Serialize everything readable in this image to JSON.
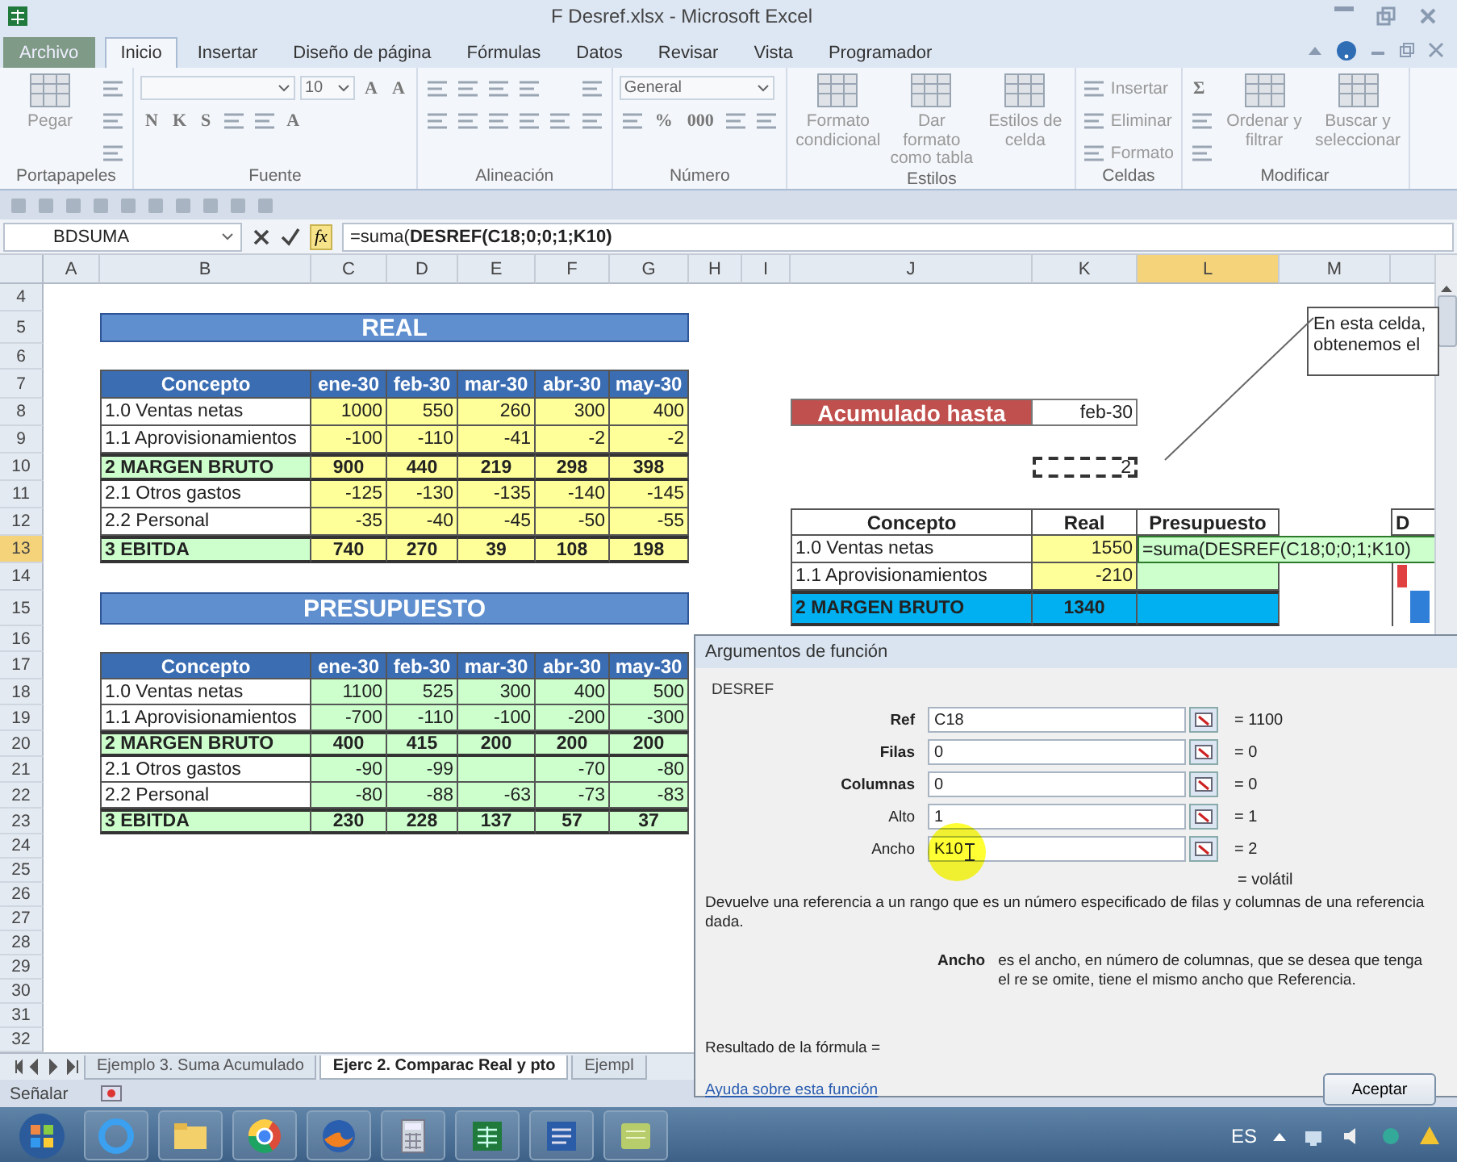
{
  "window": {
    "title": "F  Desref.xlsx  -  Microsoft Excel"
  },
  "ribbon_tabs": [
    {
      "label": "Archivo",
      "kind": "file",
      "selected": false
    },
    {
      "label": "Inicio",
      "kind": "tab",
      "selected": true
    },
    {
      "label": "Insertar",
      "kind": "tab",
      "selected": false
    },
    {
      "label": "Diseño de página",
      "kind": "tab",
      "selected": false
    },
    {
      "label": "Fórmulas",
      "kind": "tab",
      "selected": false
    },
    {
      "label": "Datos",
      "kind": "tab",
      "selected": false
    },
    {
      "label": "Revisar",
      "kind": "tab",
      "selected": false
    },
    {
      "label": "Vista",
      "kind": "tab",
      "selected": false
    },
    {
      "label": "Programador",
      "kind": "tab",
      "selected": false
    }
  ],
  "ribbon_groups": [
    {
      "label": "Portapapeles",
      "columns": [
        {
          "kind": "large",
          "label": "Pegar"
        },
        {
          "kind": "stack",
          "rows": [
            [
              {
                "kind": "icon"
              }
            ],
            [
              {
                "kind": "icon"
              }
            ],
            [
              {
                "kind": "icon"
              }
            ]
          ]
        }
      ]
    },
    {
      "label": "Fuente",
      "columns": [
        {
          "kind": "stack",
          "rows": [
            [
              {
                "kind": "wide_field"
              },
              {
                "kind": "field",
                "value": "10"
              },
              {
                "kind": "glyph",
                "label": "A"
              },
              {
                "kind": "glyph",
                "label": "A"
              }
            ],
            [
              {
                "kind": "glyph",
                "label": "N"
              },
              {
                "kind": "glyph",
                "label": "K"
              },
              {
                "kind": "glyph",
                "label": "S"
              },
              {
                "kind": "icon"
              },
              {
                "kind": "icon"
              },
              {
                "kind": "glyph",
                "label": "A"
              }
            ]
          ]
        }
      ]
    },
    {
      "label": "Alineación",
      "columns": [
        {
          "kind": "stack",
          "rows": [
            [
              {
                "kind": "icon"
              },
              {
                "kind": "icon"
              },
              {
                "kind": "icon"
              },
              {
                "kind": "icon"
              }
            ],
            [
              {
                "kind": "icon"
              },
              {
                "kind": "icon"
              },
              {
                "kind": "icon"
              },
              {
                "kind": "icon"
              },
              {
                "kind": "icon"
              }
            ]
          ]
        },
        {
          "kind": "stack",
          "rows": [
            [
              {
                "kind": "icon"
              }
            ],
            [
              {
                "kind": "icon"
              }
            ]
          ]
        }
      ]
    },
    {
      "label": "Número",
      "columns": [
        {
          "kind": "stack",
          "rows": [
            [
              {
                "kind": "wide_field",
                "value": "General"
              }
            ],
            [
              {
                "kind": "icon"
              },
              {
                "kind": "glyph",
                "label": "%"
              },
              {
                "kind": "glyph",
                "label": "000"
              },
              {
                "kind": "icon"
              },
              {
                "kind": "icon"
              }
            ]
          ]
        }
      ]
    },
    {
      "label": "Estilos",
      "columns": [
        {
          "kind": "large",
          "label": "Formato condicional"
        },
        {
          "kind": "large",
          "label": "Dar formato como tabla"
        },
        {
          "kind": "large",
          "label": "Estilos de celda"
        }
      ]
    },
    {
      "label": "Celdas",
      "columns": [
        {
          "kind": "stack",
          "rows": [
            [
              {
                "kind": "small",
                "label": "Insertar"
              }
            ],
            [
              {
                "kind": "small",
                "label": "Eliminar"
              }
            ],
            [
              {
                "kind": "small",
                "label": "Formato"
              }
            ]
          ]
        }
      ]
    },
    {
      "label": "Modificar",
      "columns": [
        {
          "kind": "stack",
          "rows": [
            [
              {
                "kind": "glyph",
                "label": "Σ"
              }
            ],
            [
              {
                "kind": "icon"
              }
            ],
            [
              {
                "kind": "icon"
              }
            ]
          ]
        },
        {
          "kind": "large",
          "label": "Ordenar y filtrar"
        },
        {
          "kind": "large",
          "label": "Buscar y seleccionar"
        }
      ]
    }
  ],
  "formula_bar": {
    "name_box": "BDSUMA",
    "function_label": "fx",
    "formula": "=suma(**DESREF(C18;0;0;1;K10)**"
  },
  "sheet": {
    "columns": [
      {
        "label": "A",
        "selected": false
      },
      {
        "label": "B",
        "selected": false
      },
      {
        "label": "C",
        "selected": false
      },
      {
        "label": "D",
        "selected": false
      },
      {
        "label": "E",
        "selected": false
      },
      {
        "label": "F",
        "selected": false
      },
      {
        "label": "G",
        "selected": false
      },
      {
        "label": "H",
        "selected": false
      },
      {
        "label": "I",
        "selected": false
      },
      {
        "label": "J",
        "selected": false
      },
      {
        "label": "K",
        "selected": false
      },
      {
        "label": "L",
        "selected": true
      },
      {
        "label": "M",
        "selected": false
      }
    ],
    "rows": [
      {
        "label": "4",
        "selected": false
      },
      {
        "label": "5",
        "selected": false
      },
      {
        "label": "6",
        "selected": false
      },
      {
        "label": "7",
        "selected": false
      },
      {
        "label": "8",
        "selected": false
      },
      {
        "label": "9",
        "selected": false
      },
      {
        "label": "10",
        "selected": false
      },
      {
        "label": "11",
        "selected": false
      },
      {
        "label": "12",
        "selected": false
      },
      {
        "label": "13",
        "selected": true
      },
      {
        "label": "14",
        "selected": false
      },
      {
        "label": "15",
        "selected": false
      },
      {
        "label": "16",
        "selected": false
      },
      {
        "label": "17",
        "selected": false
      },
      {
        "label": "18",
        "selected": false
      },
      {
        "label": "19",
        "selected": false
      },
      {
        "label": "20",
        "selected": false
      },
      {
        "label": "21",
        "selected": false
      },
      {
        "label": "22",
        "selected": false
      },
      {
        "label": "23",
        "selected": false
      },
      {
        "label": "24",
        "selected": false
      },
      {
        "label": "25",
        "selected": false
      },
      {
        "label": "26",
        "selected": false
      },
      {
        "label": "27",
        "selected": false
      },
      {
        "label": "28",
        "selected": false
      },
      {
        "label": "29",
        "selected": false
      },
      {
        "label": "30",
        "selected": false
      },
      {
        "label": "31",
        "selected": false
      },
      {
        "label": "32",
        "selected": false
      }
    ],
    "real_table": {
      "banner": "REAL",
      "columns": [
        "Concepto",
        "ene-30",
        "feb-30",
        "mar-30",
        "abr-30",
        "may-30"
      ],
      "rows": [
        {
          "kind": "item",
          "label": "1.0 Ventas netas",
          "values": [
            "1000",
            "550",
            "260",
            "300",
            "400"
          ]
        },
        {
          "kind": "item",
          "label": "1.1 Aprovisionamientos",
          "values": [
            "-100",
            "-110",
            "-41",
            "-2",
            "-2"
          ]
        },
        {
          "kind": "total",
          "label": "2 MARGEN BRUTO",
          "values": [
            "900",
            "440",
            "219",
            "298",
            "398"
          ]
        },
        {
          "kind": "item",
          "label": "2.1 Otros gastos",
          "values": [
            "-125",
            "-130",
            "-135",
            "-140",
            "-145"
          ]
        },
        {
          "kind": "item",
          "label": "2.2 Personal",
          "values": [
            "-35",
            "-40",
            "-45",
            "-50",
            "-55"
          ]
        },
        {
          "kind": "total",
          "label": "3 EBITDA",
          "values": [
            "740",
            "270",
            "39",
            "108",
            "198"
          ]
        }
      ]
    },
    "budget_table": {
      "banner": "PRESUPUESTO",
      "columns": [
        "Concepto",
        "ene-30",
        "feb-30",
        "mar-30",
        "abr-30",
        "may-30"
      ],
      "rows": [
        {
          "kind": "item",
          "label": "1.0 Ventas netas",
          "values": [
            "1100",
            "525",
            "300",
            "400",
            "500"
          ]
        },
        {
          "kind": "item",
          "label": "1.1 Aprovisionamientos",
          "values": [
            "-700",
            "-110",
            "-100",
            "-200",
            "-300"
          ]
        },
        {
          "kind": "total",
          "label": "2 MARGEN BRUTO",
          "values": [
            "400",
            "415",
            "200",
            "200",
            "200"
          ]
        },
        {
          "kind": "item",
          "label": "2.1 Otros gastos",
          "values": [
            "-90",
            "-99",
            {
              "kind": "empty"
            },
            "-70",
            "-80"
          ]
        },
        {
          "kind": "item",
          "label": "2.2 Personal",
          "values": [
            "-80",
            "-88",
            "-63",
            "-73",
            "-83"
          ]
        },
        {
          "kind": "total",
          "label": "3 EBITDA",
          "values": [
            "230",
            "228",
            "137",
            "57",
            "37"
          ]
        }
      ]
    },
    "cutoff": {
      "label": "Acumulado hasta",
      "value": "feb-30"
    },
    "copied_cell": {
      "value": "2"
    },
    "comparison_table": {
      "columns": [
        "Concepto",
        "Real",
        "Presupuesto"
      ],
      "rows": [
        {
          "kind": "item",
          "label": "1.0 Ventas netas",
          "real": "1550",
          "budget": "=suma(DESREF(C18;0;0;1;K10)",
          "editing": true
        },
        {
          "kind": "item",
          "label": "1.1 Aprovisionamientos",
          "real": "-210",
          "editing": false
        },
        {
          "kind": "total",
          "label": "2 MARGEN BRUTO",
          "real": "1340",
          "editing": false
        }
      ]
    },
    "partial_header": "D",
    "callout": {
      "lines": [
        "En esta celda,",
        "obtenemos el"
      ]
    }
  },
  "dialog": {
    "title": "Argumentos de función",
    "function": "DESREF",
    "args": [
      {
        "label": "Ref",
        "required": true,
        "value": "C18",
        "result": "= 1100"
      },
      {
        "label": "Filas",
        "required": true,
        "value": "0",
        "result": "= 0"
      },
      {
        "label": "Columnas",
        "required": true,
        "value": "0",
        "result": "= 0"
      },
      {
        "label": "Alto",
        "required": false,
        "value": "1",
        "result": "= 1"
      },
      {
        "label": "Ancho",
        "required": false,
        "value": "K10",
        "result": "= 2"
      }
    ],
    "total": "= volátil",
    "description": "Devuelve una referencia a un rango que es un número especificado de filas y columnas de una referencia dada.",
    "arg_help_label": "Ancho",
    "arg_help": "es el ancho, en número de columnas, que se desea que tenga el re se omite, tiene el mismo ancho que Referencia.",
    "result_label": "Resultado de la fórmula =",
    "help_link": "Ayuda sobre esta función",
    "ok_button": "Aceptar"
  },
  "sheet_tabs": [
    {
      "label": "Ejemplo 3. Suma Acumulado",
      "selected": false
    },
    {
      "label": "Ejerc 2. Comparac Real y pto",
      "selected": true
    },
    {
      "label": "Ejempl",
      "selected": false
    }
  ],
  "status_bar": {
    "mode": "Señalar"
  },
  "taskbar": {
    "language": "ES"
  }
}
